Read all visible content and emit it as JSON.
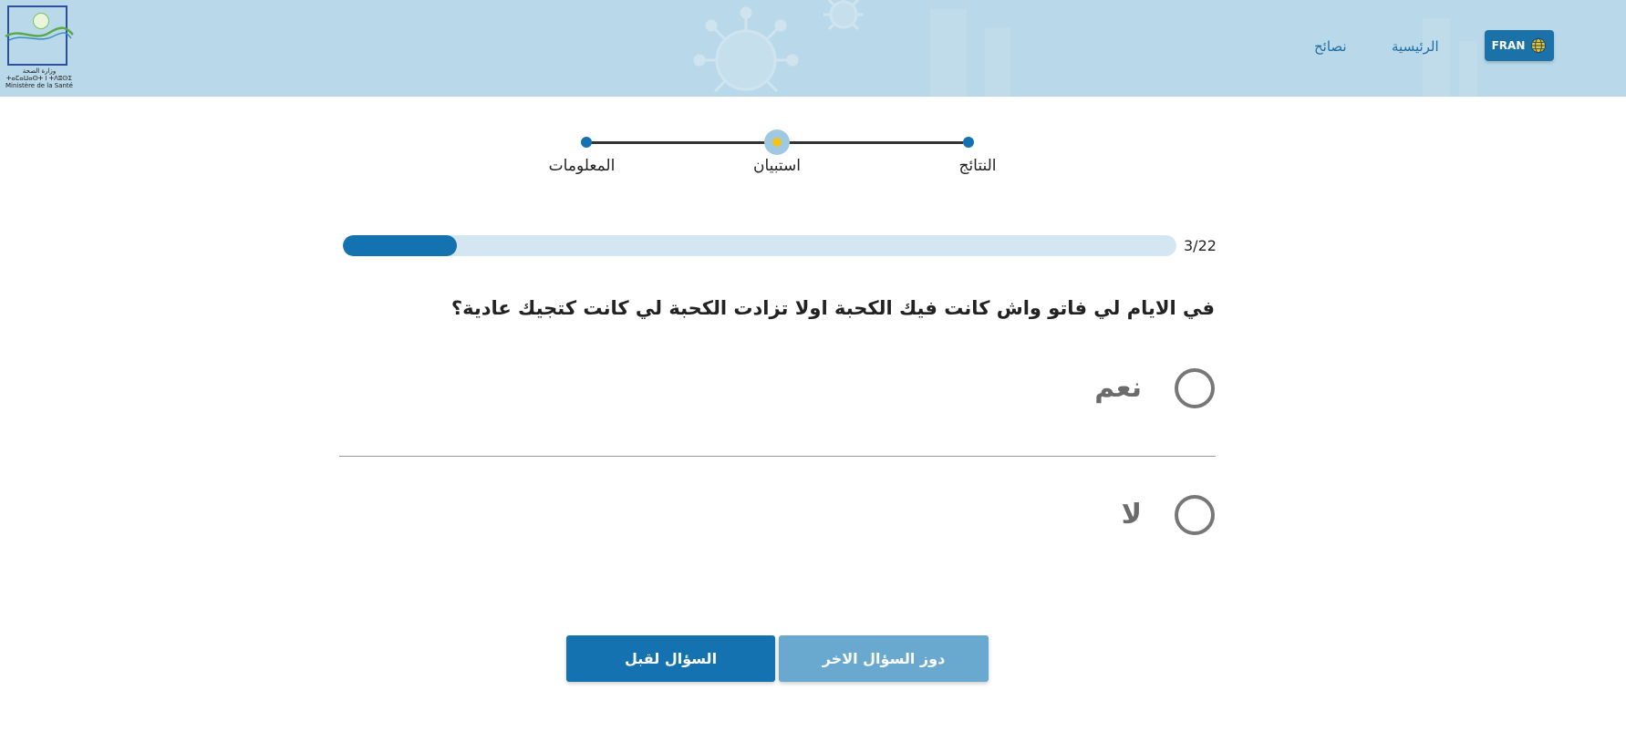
{
  "header": {
    "logo": {
      "caption_line1": "وزارة الصحة",
      "caption_line2": "ⵜⴰⵎⴰⵡⴰⵙⵜ ⵏ ⵜⴷⵓⵙⵉ",
      "caption_line3": "Ministère de la Santé"
    },
    "nav": {
      "advice": "نصائح",
      "home": "الرئيسية"
    },
    "language_button": {
      "label": "FRAN",
      "icon": "globe-icon"
    }
  },
  "stepper": {
    "steps": [
      {
        "label": "المعلومات",
        "state": "done"
      },
      {
        "label": "استبيان",
        "state": "active"
      },
      {
        "label": "النتائج",
        "state": "pending"
      }
    ]
  },
  "progress": {
    "current": 3,
    "total": 22,
    "text": "3/22"
  },
  "question": {
    "text": "في الايام لي فاتو واش كانت فيك الكحبة اولا تزادت الكحبة لي كانت كتجيك عادية؟",
    "options": [
      {
        "label": "نعم",
        "selected": false
      },
      {
        "label": "لا",
        "selected": false
      }
    ]
  },
  "actions": {
    "previous": "السؤال لقبل",
    "skip": "دوز السؤال الاخر"
  },
  "colors": {
    "primary": "#1572b0",
    "header_bg": "#b9d9ea",
    "skip_button": "#69a9cf",
    "progress_track": "#d3e6f2",
    "active_step_accent": "#f2c417"
  }
}
